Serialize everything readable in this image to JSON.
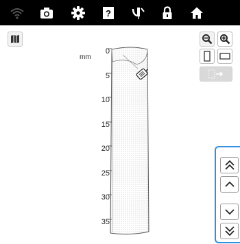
{
  "toolbar": {
    "items": [
      {
        "name": "wifi-icon"
      },
      {
        "name": "camera-icon"
      },
      {
        "name": "gear-icon"
      },
      {
        "name": "help-icon"
      },
      {
        "name": "needle-icon"
      },
      {
        "name": "lock-icon"
      },
      {
        "name": "home-icon"
      }
    ]
  },
  "ruler": {
    "unit": "mm",
    "ticks": [
      "0",
      "5",
      "10",
      "15",
      "20",
      "25",
      "30",
      "35"
    ]
  },
  "colors": {
    "toolbar_bg": "#000000",
    "accent": "#2f8fe0",
    "button_border": "#c8c8c8",
    "disabled_bg": "#d9d9d9"
  }
}
